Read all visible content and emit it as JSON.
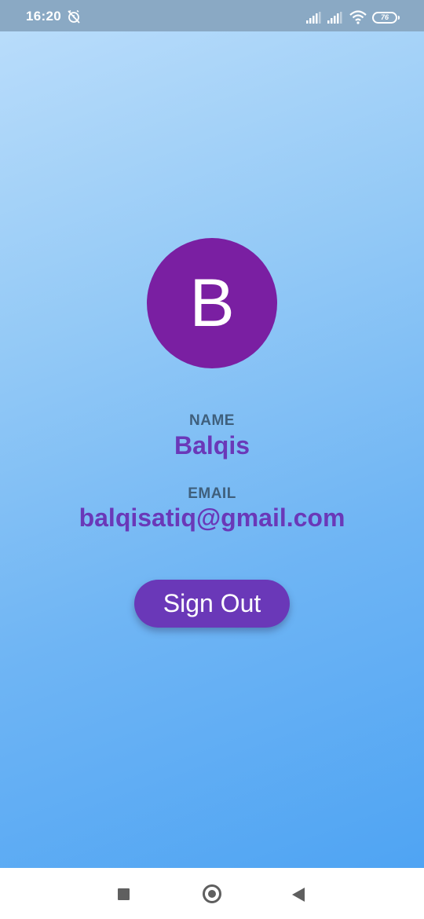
{
  "status_bar": {
    "time": "16:20",
    "battery_level": "76",
    "icons": [
      "alarm-off-icon",
      "cell-signal-icon",
      "cell-signal-icon",
      "wifi-icon",
      "battery-icon"
    ]
  },
  "profile": {
    "avatar_initial": "B",
    "avatar_color": "#7a1fa2",
    "name_label": "NAME",
    "name_value": "Balqis",
    "email_label": "EMAIL",
    "email_value": "balqisatiq@gmail.com"
  },
  "actions": {
    "sign_out_label": "Sign Out",
    "accent_color": "#6a38b8"
  },
  "nav_bar": {
    "icons": [
      "recents-icon",
      "home-icon",
      "back-icon"
    ]
  }
}
